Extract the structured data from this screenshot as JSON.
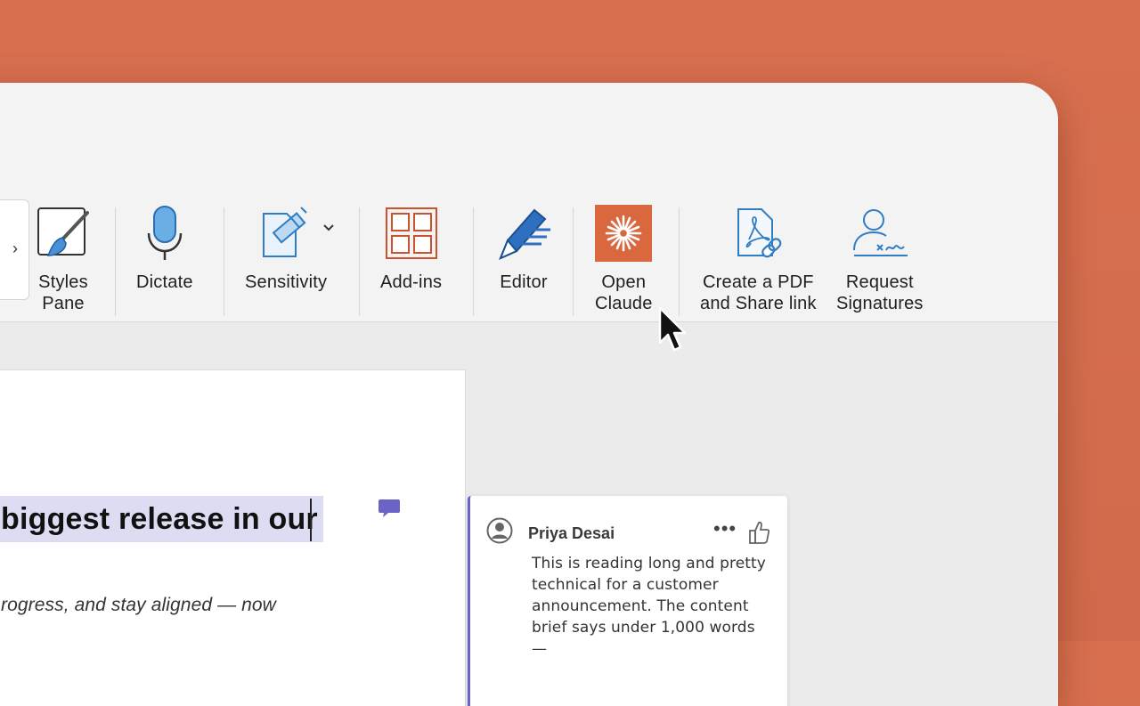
{
  "ribbon": {
    "styles_pane_label": "Styles\nPane",
    "dictate_label": "Dictate",
    "sensitivity_label": "Sensitivity",
    "addins_label": "Add-ins",
    "editor_label": "Editor",
    "open_claude_label": "Open\nClaude",
    "create_pdf_label": "Create a PDF\nand Share link",
    "request_signatures_label": "Request\nSignatures",
    "gallery_arrow": "›"
  },
  "document": {
    "heading_fragment": "biggest release in our",
    "body_fragment": "rogress, and stay aligned — now"
  },
  "comment": {
    "author": "Priya Desai",
    "more": "•••",
    "text": "This is reading long and pretty technical for a customer announcement. The content brief says under 1,000 words —"
  },
  "colors": {
    "background": "#d8704f",
    "claude_tile": "#d9683f",
    "accent_blue": "#2e7dc5",
    "comment_accent": "#6b63c6",
    "selection": "#dcdcf3"
  },
  "icons": [
    "styles-pane-icon",
    "microphone-icon",
    "sensitivity-icon",
    "add-ins-icon",
    "editor-pen-icon",
    "claude-icon",
    "pdf-link-icon",
    "signature-icon",
    "comment-icon",
    "avatar-icon",
    "thumbs-up-icon",
    "mouse-pointer-icon"
  ]
}
